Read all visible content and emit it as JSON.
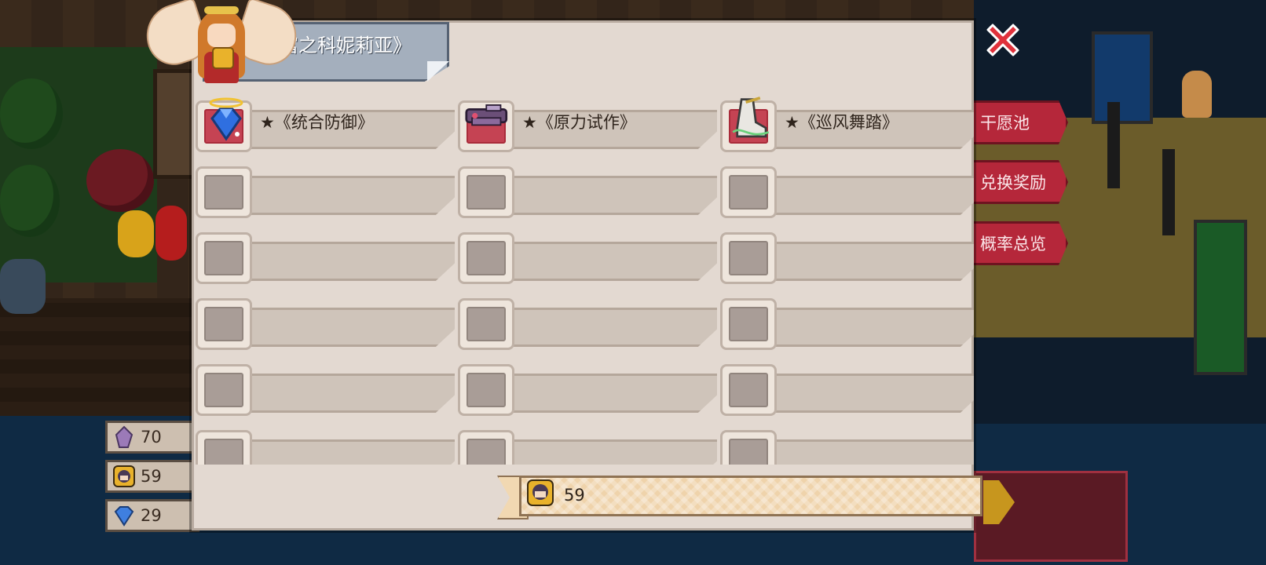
{
  "dialog": {
    "title": "富之科妮莉亚》",
    "close_icon": "close-x-icon",
    "accent_color": "#d8303b"
  },
  "rewards": {
    "rows": [
      [
        {
          "label": "★《统合防御》",
          "icon": "blue-gem-halo-icon",
          "filled": true
        },
        {
          "label": "★《原力试作》",
          "icon": "plasma-gun-icon",
          "filled": true
        },
        {
          "label": "★《巡风舞踏》",
          "icon": "wind-boots-icon",
          "filled": true
        }
      ],
      [
        {
          "label": "",
          "filled": false
        },
        {
          "label": "",
          "filled": false
        },
        {
          "label": "",
          "filled": false
        }
      ],
      [
        {
          "label": "",
          "filled": false
        },
        {
          "label": "",
          "filled": false
        },
        {
          "label": "",
          "filled": false
        }
      ],
      [
        {
          "label": "",
          "filled": false
        },
        {
          "label": "",
          "filled": false
        },
        {
          "label": "",
          "filled": false
        }
      ],
      [
        {
          "label": "",
          "filled": false
        },
        {
          "label": "",
          "filled": false
        },
        {
          "label": "",
          "filled": false
        }
      ],
      [
        {
          "label": "",
          "filled": false
        },
        {
          "label": "",
          "filled": false
        },
        {
          "label": "",
          "filled": false
        }
      ]
    ]
  },
  "footer": {
    "count": "59",
    "icon": "character-token-icon"
  },
  "side_menu": {
    "items": [
      "干愿池",
      "兑换奖励",
      "概率总览"
    ]
  },
  "currency": [
    {
      "icon": "purple-crystal-icon",
      "value": "70"
    },
    {
      "icon": "character-token-icon",
      "value": "59"
    },
    {
      "icon": "blue-gem-icon",
      "value": "29"
    }
  ]
}
